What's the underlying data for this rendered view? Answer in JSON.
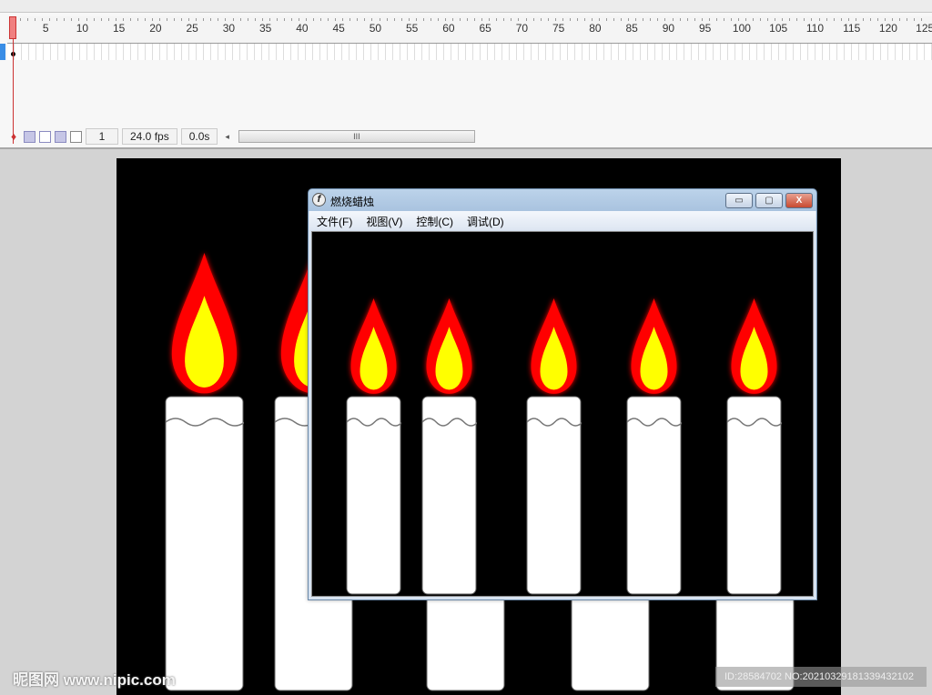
{
  "timeline": {
    "ruler_labels": [
      "1",
      "5",
      "10",
      "15",
      "20",
      "25",
      "30",
      "35",
      "40",
      "45",
      "50",
      "55",
      "60",
      "65",
      "70",
      "75",
      "80",
      "85",
      "90",
      "95",
      "100",
      "105",
      "110",
      "115",
      "120",
      "125"
    ],
    "current_frame": "1",
    "fps": "24.0 fps",
    "elapsed": "0.0s",
    "scroll_grip": "III"
  },
  "player": {
    "title": "燃烧蜡烛",
    "app_icon": "f",
    "menu": [
      "文件(F)",
      "视图(V)",
      "控制(C)",
      "调试(D)"
    ],
    "buttons": {
      "minimize": "▭",
      "maximize": "▢",
      "close": "X"
    }
  },
  "colors": {
    "flame_outer": "#ff0000",
    "flame_inner": "#ffff00",
    "candle": "#ffffff",
    "stage": "#000000"
  },
  "watermark": {
    "logo": "昵图网 www.nipic.com",
    "id": "ID:28584702 NO:20210329181339432102"
  }
}
